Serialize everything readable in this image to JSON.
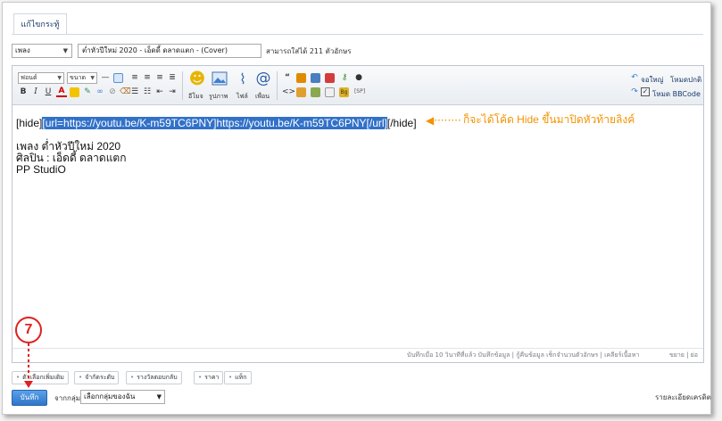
{
  "tab": {
    "label": "แก้ไขกระทู้"
  },
  "post": {
    "category_value": "เพลง",
    "title_value": "ต่ำหัวปีใหม่ 2020 - เอ็ดดี้ ดลาดแตก - (Cover)",
    "title_remaining": "สามารถใส่ได้ 211 ตัวอักษร"
  },
  "toolbar": {
    "font_select": "ฟอนต์",
    "size_select": "ขนาด",
    "emoji_label": "อีโมจ",
    "image_label": "รูปภาพ",
    "file_label": "ไฟล์",
    "mention_label": "เพื่อน",
    "fullscreen_label": "จอใหญ่",
    "normal_mode_label": "โหมดปกติ",
    "bbcode_label": "โหมด BBCode",
    "bbcode_checked": true,
    "spoiler_label": "[SP]",
    "bg_label": "Bg"
  },
  "content": {
    "hide_open": "[hide]",
    "hide_link": "[url=https://youtu.be/K-m59TC6PNY]https://youtu.be/K-m59TC6PNY[/url]",
    "hide_close": "[/hide]",
    "line_song": "เพลง   ต่ำหัวปีใหม่ 2020",
    "line_artist": "ศิลปิน : เอ็ดดี้ ดลาดแตก",
    "line_studio": "PP StudiO"
  },
  "annotation": {
    "arrow": "◀········",
    "text": "ก็จะได้โค้ด Hide ขึ้นมาปิดหัวท้ายลิงค์",
    "color": "#f39200",
    "step_number": "7",
    "step_color": "#e02020"
  },
  "statusbar": {
    "left": "บันทึกเมื่อ 10 วินาทีที่แล้ว  บันทึกข้อมูล | กู้คืนข้อมูล    เช็กจำนวนตัวอักษร | เคลียร์เนื้อหา",
    "right": "ขยาย | ย่อ"
  },
  "chips": [
    "ตัวเลือกเพิ่มเติม",
    "จำกัดระดับ",
    "รางวัลตอบกลับ",
    "ราคา",
    "แท็ก"
  ],
  "footer": {
    "save_label": "บันทึก",
    "group_label": "จากกลุ่ม:",
    "group_select": "เลือกกลุ่มของฉัน",
    "credit_link": "รายละเอียดเครดิต"
  },
  "colors": {
    "accent": "#2f76c9",
    "highlight": "#3271c8"
  }
}
